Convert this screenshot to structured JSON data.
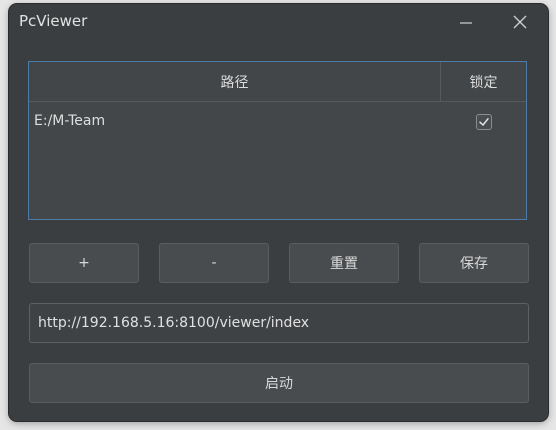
{
  "window": {
    "title": "PcViewer"
  },
  "table": {
    "columns": [
      "路径",
      "锁定"
    ],
    "rows": [
      {
        "path": "E:/M-Team",
        "locked": true
      }
    ]
  },
  "buttons": {
    "add_label": "+",
    "remove_label": "-",
    "reset_label": "重置",
    "save_label": "保存",
    "start_label": "启动"
  },
  "url_field": {
    "value": "http://192.168.5.16:8100/viewer/index"
  },
  "colors": {
    "window_bg": "#3b3e41",
    "table_border_accent": "#4d7aa8",
    "button_bg": "#494c4f",
    "text": "#dcdcdc"
  },
  "icons": {
    "minimize": "minimize-icon",
    "close": "close-icon",
    "checkbox": "checkmark-icon"
  }
}
